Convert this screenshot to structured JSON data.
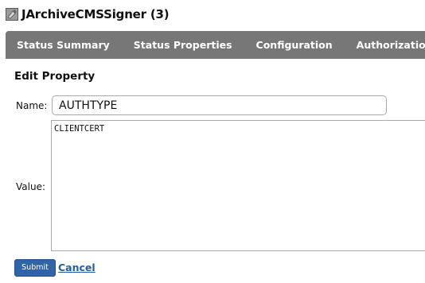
{
  "header": {
    "icon": "worker-icon",
    "title": "JArchiveCMSSigner (3)"
  },
  "tabs": [
    {
      "label": "Status Summary"
    },
    {
      "label": "Status Properties"
    },
    {
      "label": "Configuration"
    },
    {
      "label": "Authorization"
    }
  ],
  "form": {
    "section_title": "Edit Property",
    "name_label": "Name:",
    "name_value": "AUTHTYPE",
    "value_label": "Value:",
    "value_text": "CLIENTCERT",
    "submit_label": "Submit",
    "cancel_label": "Cancel"
  },
  "colors": {
    "tabbar_bg": "#777777",
    "submit_bg": "#2f64a8",
    "link": "#1f5fa8"
  }
}
